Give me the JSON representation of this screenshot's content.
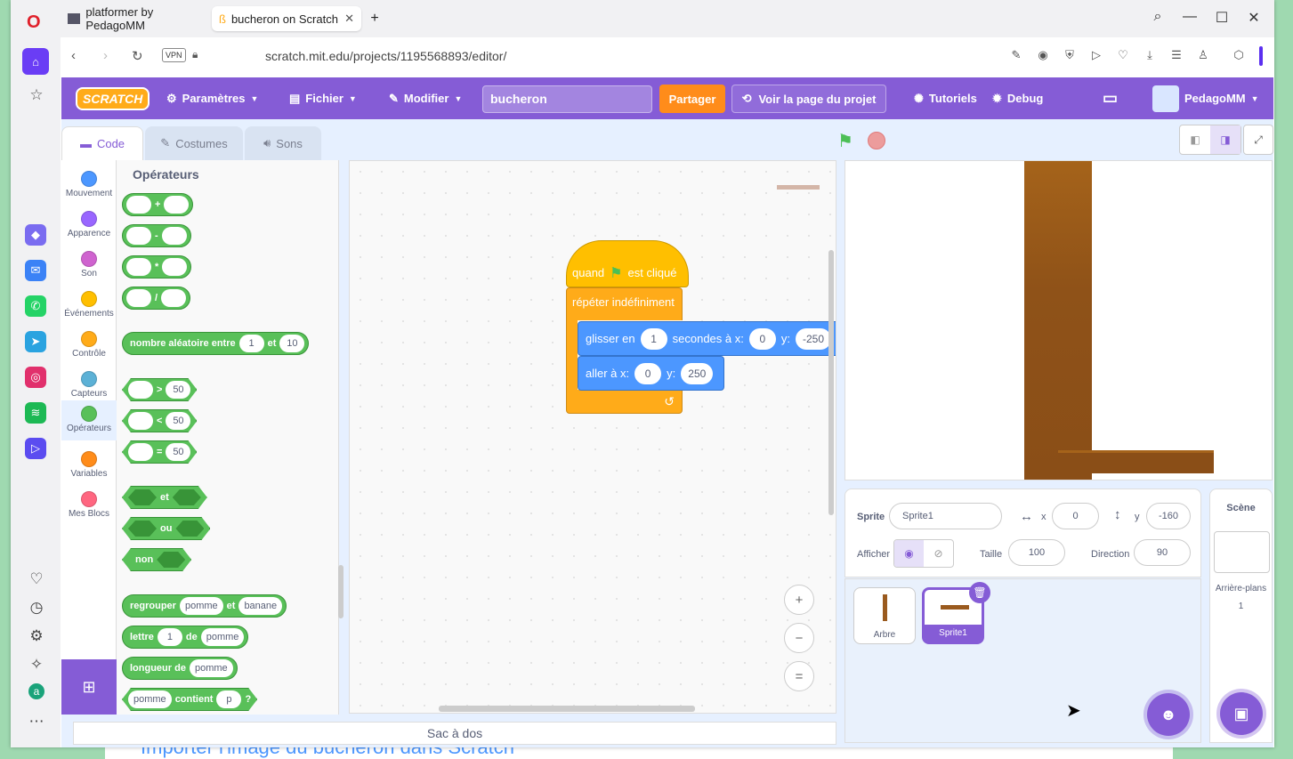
{
  "background_page": {
    "text": "Importer l'image du bucheron dans Scratch"
  },
  "browser": {
    "tabs": [
      {
        "label": "platformer by PedagoMM"
      },
      {
        "label": "bucheron on Scratch"
      }
    ],
    "vpn": "VPN",
    "url": "scratch.mit.edu/projects/1195568893/editor/"
  },
  "menu": {
    "logo": "SCRATCH",
    "settings": "Paramètres",
    "file": "Fichier",
    "edit": "Modifier",
    "project_title": "bucheron",
    "share": "Partager",
    "project_page": "Voir la page du projet",
    "tutorials": "Tutoriels",
    "debug": "Debug",
    "username": "PedagoMM"
  },
  "editor_tabs": {
    "code": "Code",
    "costumes": "Costumes",
    "sounds": "Sons"
  },
  "categories": [
    {
      "label": "Mouvement",
      "color": "#4c97ff"
    },
    {
      "label": "Apparence",
      "color": "#9966ff"
    },
    {
      "label": "Son",
      "color": "#cf63cf"
    },
    {
      "label": "Événements",
      "color": "#ffbf00"
    },
    {
      "label": "Contrôle",
      "color": "#ffab19"
    },
    {
      "label": "Capteurs",
      "color": "#5cb1d6"
    },
    {
      "label": "Opérateurs",
      "color": "#59c059"
    },
    {
      "label": "Variables",
      "color": "#ff8c1a"
    },
    {
      "label": "Mes Blocs",
      "color": "#ff6680"
    }
  ],
  "palette": {
    "title": "Opérateurs",
    "add": "+",
    "sub": "-",
    "mul": "*",
    "div": "/",
    "random_label": "nombre aléatoire entre",
    "random_a": "1",
    "random_and": "et",
    "random_b": "10",
    "gt": ">",
    "lt": "<",
    "eq": "=",
    "cmp_value": "50",
    "and": "et",
    "or": "ou",
    "not": "non",
    "join_label": "regrouper",
    "join_a": "pomme",
    "join_and": "et",
    "join_b": "banane",
    "letter_label": "lettre",
    "letter_n": "1",
    "letter_of": "de",
    "letter_word": "pomme",
    "length_label": "longueur de",
    "length_word": "pomme",
    "contains_word": "pomme",
    "contains_label": "contient",
    "contains_char": "p",
    "contains_q": "?"
  },
  "script": {
    "hat_when": "quand",
    "hat_clicked": "est cliqué",
    "forever": "répéter indéfiniment",
    "glide_label": "glisser en",
    "glide_secs": "1",
    "glide_to_x": "secondes à x:",
    "glide_x": "0",
    "glide_y_label": "y:",
    "glide_y": "-250",
    "goto_label": "aller à x:",
    "goto_x": "0",
    "goto_y_label": "y:",
    "goto_y": "250"
  },
  "zoom": {
    "in": "+",
    "out": "−",
    "reset": "="
  },
  "backpack": "Sac à dos",
  "sprite_info": {
    "sprite_label": "Sprite",
    "sprite_name": "Sprite1",
    "x_label": "x",
    "x": "0",
    "y_label": "y",
    "y": "-160",
    "show_label": "Afficher",
    "size_label": "Taille",
    "size": "100",
    "direction_label": "Direction",
    "direction": "90"
  },
  "sprites": [
    {
      "name": "Arbre"
    },
    {
      "name": "Sprite1"
    }
  ],
  "stage_panel": {
    "title": "Scène",
    "backdrops_label": "Arrière-plans",
    "backdrops_count": "1"
  },
  "colors": {
    "scratch_purple": "#855cd6",
    "operators_green": "#59c059",
    "events_yellow": "#ffbf00",
    "control_orange": "#ffab19",
    "motion_blue": "#4c97ff",
    "tree_brown": "#9a5a1e"
  }
}
